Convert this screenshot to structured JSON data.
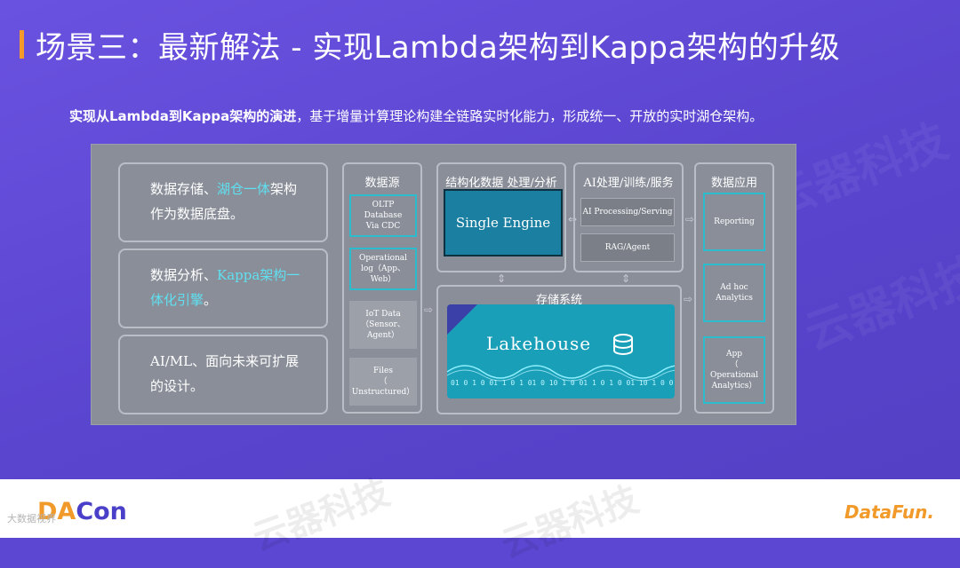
{
  "title": "场景三：最新解法 - 实现Lambda架构到Kappa架构的升级",
  "subtitle": {
    "bold": "实现从Lambda到Kappa架构的演进",
    "rest": "，基于增量计算理论构建全链路实时化能力，形成统一、开放的实时湖仓架构。"
  },
  "left_boxes": [
    {
      "a": "数据存储、",
      "hl": "湖仓一体",
      "b": "架构",
      "c": "作为数据底盘。"
    },
    {
      "a": "数据分析、",
      "hl": "Kappa架构一",
      "hl2": "体化引擎",
      "c": "。"
    },
    {
      "a": "AI/ML、面向未来可扩展",
      "c": "的设计。"
    }
  ],
  "data_sources": {
    "title": "数据源",
    "items": [
      {
        "l1": "OLTP",
        "l2": "Database",
        "l3": "Via CDC"
      },
      {
        "l1": "Operational",
        "l2": "log（App、",
        "l3": "Web）"
      },
      {
        "l1": "IoT Data",
        "l2": "（Sensor、",
        "l3": "Agent）"
      },
      {
        "l1": "Files",
        "l2": "（",
        "l3": "Unstructured）"
      }
    ]
  },
  "structured": {
    "title": "结构化数据 处理/分析",
    "engine": "Single Engine"
  },
  "ai": {
    "title": "AI处理/训练/服务",
    "items": [
      "AI Processing/Serving",
      "RAG/Agent"
    ]
  },
  "storage": {
    "title": "存储系统",
    "lakehouse": "Lakehouse",
    "binary": "01 0 1 0 01 1 0 1 01 0 10 1 0 01 1 0 1 0 01 10 1 0 01 1 0"
  },
  "apps": {
    "title": "数据应用",
    "items": [
      {
        "l1": "Reporting"
      },
      {
        "l1": "Ad hoc",
        "l2": "Analytics"
      },
      {
        "l1": "App",
        "l2": "（",
        "l3": "Operational",
        "l4": "Analytics）"
      }
    ]
  },
  "footer": {
    "dacon_1": "DA",
    "dacon_2": "Con",
    "small": "大数据视界",
    "datafun": "DataFun."
  },
  "watermark": "云器科技",
  "colors": {
    "bg": "#5b47d1",
    "accent": "#f39a2b",
    "teal": "#2bbccd",
    "highlight": "#5fe0f0"
  }
}
